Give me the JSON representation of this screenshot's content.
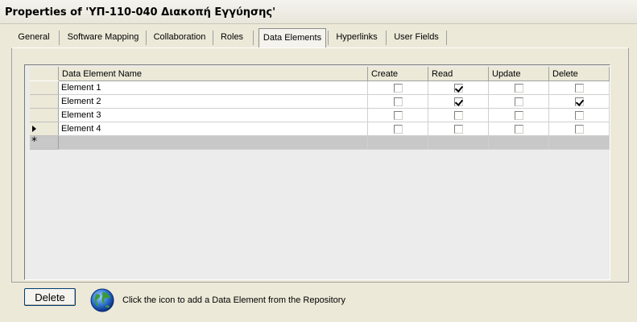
{
  "window": {
    "title": "Properties of 'ΥΠ-110-040 Διακοπή Εγγύησης'"
  },
  "tabs": [
    {
      "label": "General"
    },
    {
      "label": "Software Mapping"
    },
    {
      "label": "Collaboration"
    },
    {
      "label": "Roles"
    },
    {
      "label": "Data Elements",
      "selected": true
    },
    {
      "label": "Hyperlinks"
    },
    {
      "label": "User Fields"
    }
  ],
  "grid": {
    "columns": [
      "Data Element Name",
      "Create",
      "Read",
      "Update",
      "Delete"
    ],
    "rows": [
      {
        "name": "Element 1",
        "create": false,
        "read": true,
        "update": false,
        "delete": false
      },
      {
        "name": "Element 2",
        "create": false,
        "read": true,
        "update": false,
        "delete": true
      },
      {
        "name": "Element 3",
        "create": false,
        "read": false,
        "update": false,
        "delete": false
      },
      {
        "name": "Element 4",
        "create": false,
        "read": false,
        "update": false,
        "delete": false,
        "current": true
      }
    ],
    "new_row_marker": "*"
  },
  "footer": {
    "delete_label": "Delete",
    "icon": "globe-icon",
    "hint": "Click the icon to add a Data Element from the Repository"
  }
}
